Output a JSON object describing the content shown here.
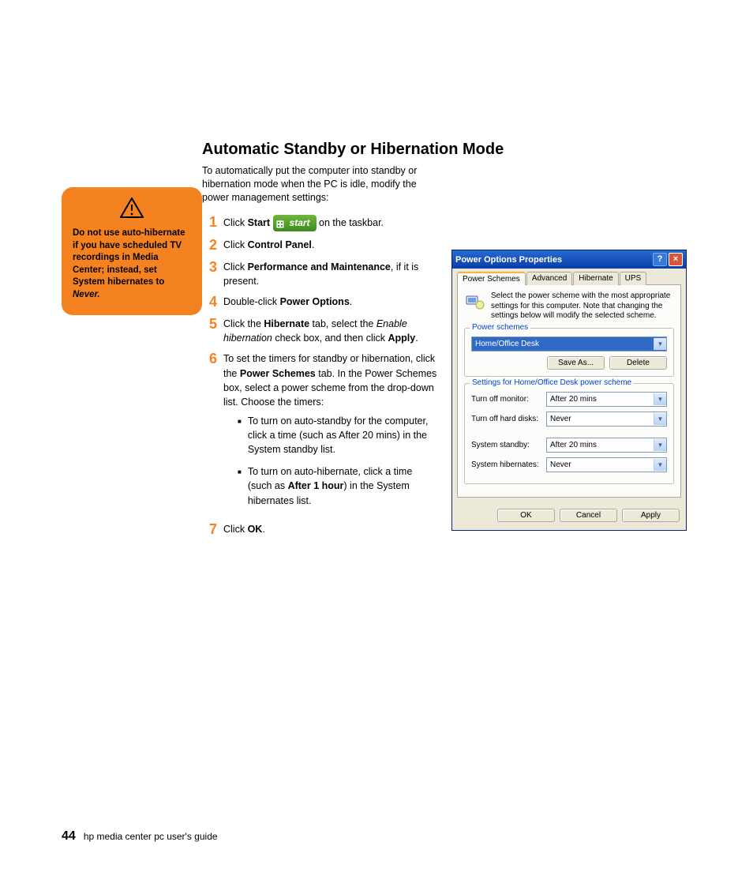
{
  "heading": "Automatic Standby or Hibernation Mode",
  "intro": "To automatically put the computer into standby or hibernation mode when the PC is idle, modify the power management settings:",
  "warning": {
    "prefix": "Do not use auto-hibernate if you have scheduled TV recordings in Media Center; instead, set System hibernates to ",
    "never": "Never."
  },
  "start_label": "start",
  "steps": {
    "s1a": "Click ",
    "s1_bold": "Start",
    "s1b": " on the taskbar.",
    "s2a": "Click ",
    "s2_bold": "Control Panel",
    "s2b": ".",
    "s3a": "Click ",
    "s3_bold": "Performance and Maintenance",
    "s3b": ", if it is present.",
    "s4a": "Double-click ",
    "s4_bold": "Power Options",
    "s4b": ".",
    "s5a": "Click the ",
    "s5_bold1": "Hibernate",
    "s5b": " tab, select the ",
    "s5_i": "Enable hibernation",
    "s5c": " check box, and then click ",
    "s5_bold2": "Apply",
    "s5d": ".",
    "s6a": "To set the timers for standby or hibernation, click the ",
    "s6_bold": "Power Schemes",
    "s6b": " tab. In the Power Schemes box, select a power scheme from the drop-down list. Choose the timers:",
    "s6_sub1": "To turn on auto-standby for the computer, click a time (such as After 20 mins) in the System standby list.",
    "s6_sub2a": "To turn on auto-hibernate, click a time (such as ",
    "s6_sub2_bold": "After 1 hour",
    "s6_sub2b": ") in the System hibernates list.",
    "s7a": "Click ",
    "s7_bold": "OK",
    "s7b": "."
  },
  "dialog": {
    "title": "Power Options Properties",
    "tabs": [
      "Power Schemes",
      "Advanced",
      "Hibernate",
      "UPS"
    ],
    "desc": "Select the power scheme with the most appropriate settings for this computer. Note that changing the settings below will modify the selected scheme.",
    "group1_title": "Power schemes",
    "scheme_selected": "Home/Office Desk",
    "save_as": "Save As...",
    "delete": "Delete",
    "group2_title": "Settings for Home/Office Desk power scheme",
    "rows": [
      {
        "label": "Turn off monitor:",
        "value": "After 20 mins"
      },
      {
        "label": "Turn off hard disks:",
        "value": "Never"
      },
      {
        "label": "System standby:",
        "value": "After 20 mins"
      },
      {
        "label": "System hibernates:",
        "value": "Never"
      }
    ],
    "ok": "OK",
    "cancel": "Cancel",
    "apply": "Apply"
  },
  "footer": {
    "page": "44",
    "title": "hp media center pc user's guide"
  }
}
